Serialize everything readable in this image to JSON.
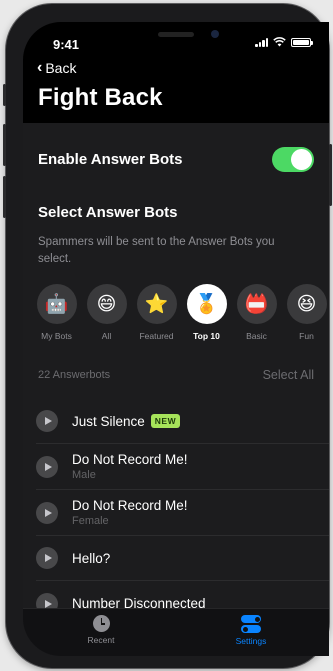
{
  "status": {
    "time": "9:41"
  },
  "nav": {
    "back_label": "Back",
    "title": "Fight Back"
  },
  "enable": {
    "label": "Enable Answer Bots",
    "on": true
  },
  "select": {
    "title": "Select Answer Bots",
    "description": "Spammers will be sent to the Answer Bots you select."
  },
  "categories": [
    {
      "label": "My Bots",
      "icon": "robot-icon",
      "glyph": "🤖",
      "active": false
    },
    {
      "label": "All",
      "icon": "faces-icon",
      "glyph": "😄",
      "active": false
    },
    {
      "label": "Featured",
      "icon": "star-icon",
      "glyph": "⭐",
      "active": false
    },
    {
      "label": "Top 10",
      "icon": "medal-icon",
      "glyph": "🏅",
      "active": true
    },
    {
      "label": "Basic",
      "icon": "hello-sticker-icon",
      "glyph": "📛",
      "active": false
    },
    {
      "label": "Fun",
      "icon": "laughing-face-icon",
      "glyph": "😆",
      "active": false
    }
  ],
  "list_header": {
    "count": "22 Answerbots",
    "select_all": "Select All"
  },
  "bots": [
    {
      "name": "Just Silence",
      "badge": "NEW",
      "sub": ""
    },
    {
      "name": "Do Not Record Me!",
      "badge": "",
      "sub": "Male"
    },
    {
      "name": "Do Not Record Me!",
      "badge": "",
      "sub": "Female"
    },
    {
      "name": "Hello?",
      "badge": "",
      "sub": ""
    },
    {
      "name": "Number Disconnected",
      "badge": "",
      "sub": ""
    }
  ],
  "tabbar": {
    "recent": "Recent",
    "settings": "Settings"
  },
  "colors": {
    "accent": "#0a84ff",
    "toggle_on": "#4cd964",
    "badge": "#a6e35a"
  }
}
